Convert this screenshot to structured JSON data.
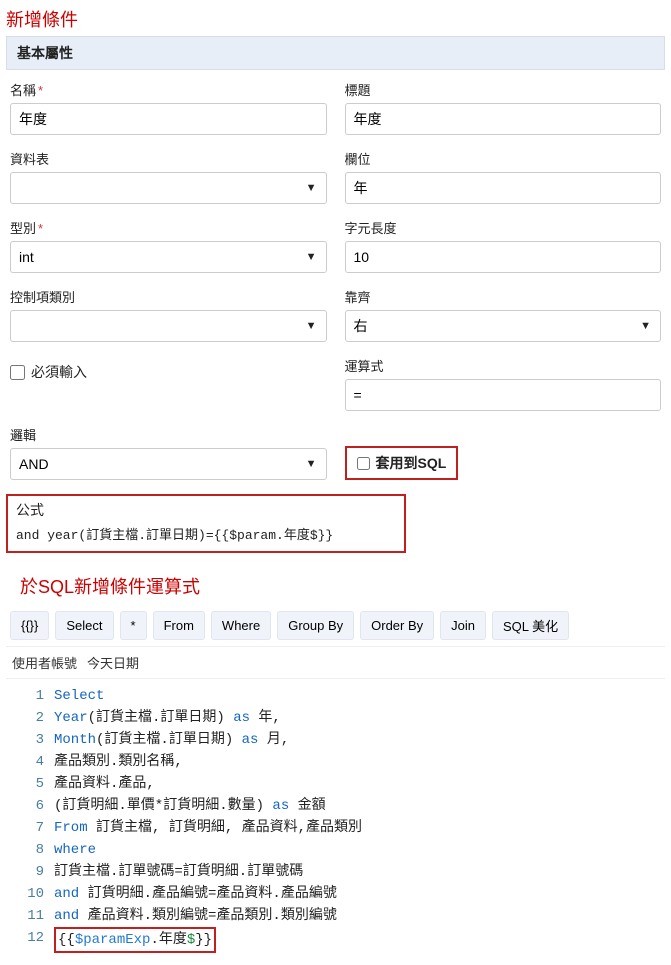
{
  "page": {
    "title": "新增條件",
    "sectionHeader": "基本屬性"
  },
  "form": {
    "name": {
      "label": "名稱",
      "required": "*",
      "value": "年度"
    },
    "title": {
      "label": "標題",
      "value": "年度"
    },
    "dataTable": {
      "label": "資料表",
      "value": ""
    },
    "column": {
      "label": "欄位",
      "value": "年"
    },
    "type": {
      "label": "型別",
      "required": "*",
      "value": "int"
    },
    "charLength": {
      "label": "字元長度",
      "value": "10"
    },
    "controlType": {
      "label": "控制項類別",
      "value": ""
    },
    "align": {
      "label": "靠齊",
      "value": "右"
    },
    "mustInput": {
      "label": "必須輸入",
      "checked": false
    },
    "operator": {
      "label": "運算式",
      "value": "="
    },
    "logic": {
      "label": "邏輯",
      "value": "AND"
    },
    "applySql": {
      "label": "套用到SQL",
      "checked": false
    }
  },
  "formula": {
    "label": "公式",
    "code": "and year(訂貨主檔.訂單日期)={{$param.年度$}}"
  },
  "sql": {
    "title": "於SQL新增條件運算式",
    "toolbar": [
      "{{}}",
      "Select",
      "*",
      "From",
      "Where",
      "Group By",
      "Order By",
      "Join",
      "SQL 美化"
    ],
    "secondary": [
      "使用者帳號",
      "今天日期"
    ],
    "lines": [
      {
        "n": 1,
        "tokens": [
          [
            "kw",
            "Select"
          ]
        ]
      },
      {
        "n": 2,
        "tokens": [
          [
            "kw",
            "Year"
          ],
          [
            "ident",
            "(訂貨主檔.訂單日期) "
          ],
          [
            "as-kw",
            "as"
          ],
          [
            "ident",
            " 年,"
          ]
        ]
      },
      {
        "n": 3,
        "tokens": [
          [
            "kw",
            "Month"
          ],
          [
            "ident",
            "(訂貨主檔.訂單日期) "
          ],
          [
            "as-kw",
            "as"
          ],
          [
            "ident",
            " 月,"
          ]
        ]
      },
      {
        "n": 4,
        "tokens": [
          [
            "ident",
            "產品類別.類別名稱,"
          ]
        ]
      },
      {
        "n": 5,
        "tokens": [
          [
            "ident",
            "產品資料.產品,"
          ]
        ]
      },
      {
        "n": 6,
        "tokens": [
          [
            "ident",
            "(訂貨明細.單價*訂貨明細.數量) "
          ],
          [
            "as-kw",
            "as"
          ],
          [
            "ident",
            " 金額"
          ]
        ]
      },
      {
        "n": 7,
        "tokens": [
          [
            "kw",
            "From"
          ],
          [
            "ident",
            " 訂貨主檔, 訂貨明細, 產品資料,產品類別"
          ]
        ]
      },
      {
        "n": 8,
        "tokens": [
          [
            "kw",
            "where"
          ]
        ]
      },
      {
        "n": 9,
        "tokens": [
          [
            "ident",
            "訂貨主檔.訂單號碼=訂貨明細.訂單號碼"
          ]
        ]
      },
      {
        "n": 10,
        "tokens": [
          [
            "kw",
            "and"
          ],
          [
            "ident",
            " 訂貨明細.產品編號=產品資料.產品編號"
          ]
        ]
      },
      {
        "n": 11,
        "tokens": [
          [
            "kw",
            "and"
          ],
          [
            "ident",
            " 產品資料.類別編號=產品類別.類別編號"
          ]
        ]
      }
    ],
    "paramLine": {
      "n": 12,
      "open": "{{",
      "prefix": "$paramExp",
      "mid": ".年度",
      "suffix": "$",
      "close": "}}"
    }
  }
}
